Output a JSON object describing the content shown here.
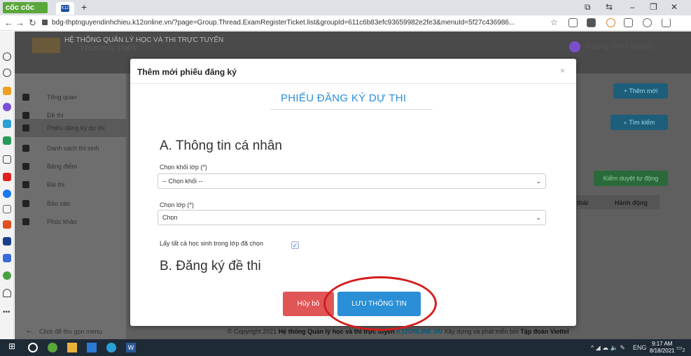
{
  "browser": {
    "brand": "cốc cốc",
    "tab_favicon": "K12",
    "new_tab": "+",
    "url": "bdg-thptnguyendinhchieu.k12online.vn/?page=Group.Thread.ExamRegisterTicket.list&groupId=611c6b83efc93659982e2fe3&menuId=5f27c436986..."
  },
  "app": {
    "title_line1": "HỆ THỐNG QUẢN LÝ HỌC VÀ THI TRỰC TUYẾN",
    "title_line2": "TRƯỜNG THPT",
    "user": "Trường THPT Nguyễn ...",
    "menu": [
      {
        "label": "Tổng quan"
      },
      {
        "label": "Đề thi"
      },
      {
        "label": "Phiếu đăng ký dự thi"
      },
      {
        "label": "Danh sách thí sinh"
      },
      {
        "label": "Bảng điểm"
      },
      {
        "label": "Bài thi"
      },
      {
        "label": "Báo cáo"
      },
      {
        "label": "Phúc khảo"
      }
    ],
    "collapse": "Click để thu gọn menu",
    "buttons": {
      "add_new": "+ Thêm mới",
      "search": "Tìm kiếm",
      "auto_review": "Kiểm duyệt tự động"
    },
    "table_headers": {
      "status": "thái",
      "action": "Hành động"
    },
    "footer": {
      "prefix": "© Copyright 2021",
      "system": "Hệ thống Quản lý học và thi trực tuyến",
      "brand": "K12ONLINE.VN",
      "middle": "Xây dựng và phát triển bởi",
      "company": "Tập đoàn Viettel"
    }
  },
  "modal": {
    "title": "Thêm mới phiếu đăng ký",
    "form_title": "PHIẾU ĐĂNG KÝ DỰ THI",
    "section_a": "A. Thông tin cá nhân",
    "grade_label": "Chọn khối lớp (*)",
    "grade_value": "-- Chọn khối --",
    "class_label": "Chọn lớp (*)",
    "class_value": "Chọn",
    "all_students_label": "Lấy tất cả học sinh trong lớp đã chọn",
    "section_b": "B. Đăng ký đề thi",
    "cancel": "Hủy bỏ",
    "save": "LƯU THÔNG TIN"
  },
  "taskbar": {
    "lang": "ENG",
    "time": "9:17 AM",
    "date": "8/18/2021",
    "notif_count": "2"
  },
  "colors": {
    "accent_blue": "#2a8fd6",
    "cancel_red": "#e05656",
    "highlight_ellipse": "#d31d1d",
    "coccoc_green": "#5aa73a"
  }
}
